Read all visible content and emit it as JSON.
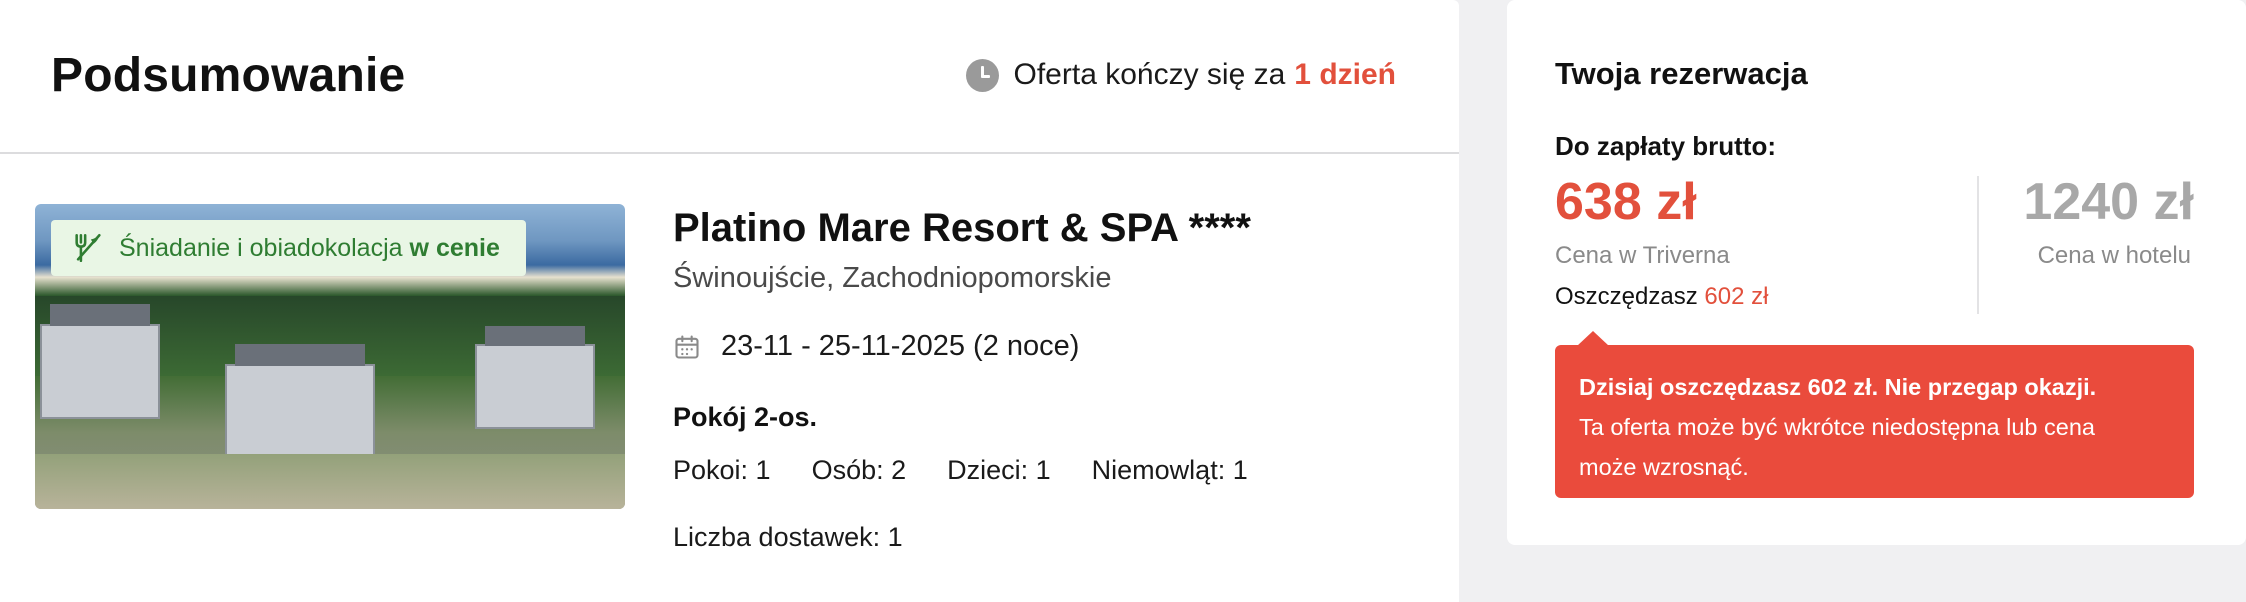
{
  "summary": {
    "title": "Podsumowanie",
    "offer_timer": {
      "prefix": "Oferta kończy się za",
      "value": "1 dzień"
    }
  },
  "hotel": {
    "meal_badge": {
      "text": "Śniadanie i obiadokolacja",
      "strong": "w cenie"
    },
    "name": "Platino Mare Resort & SPA ****",
    "location": "Świnoujście, Zachodniopomorskie",
    "dates": "23-11 - 25-11-2025 (2 noce)",
    "room_type": "Pokój 2-os.",
    "occupancy": [
      "Pokoi: 1",
      "Osób: 2",
      "Dzieci: 1",
      "Niemowląt: 1"
    ],
    "extra_beds": "Liczba dostawek: 1"
  },
  "reservation": {
    "title": "Twoja rezerwacja",
    "to_pay_label": "Do zapłaty brutto:",
    "price_triverna": "638 zł",
    "price_triverna_label": "Cena w Triverna",
    "savings_prefix": "Oszczędzasz",
    "savings_amount": "602 zł",
    "price_hotel": "1240 zł",
    "price_hotel_label": "Cena w hotelu",
    "alert": {
      "headline": "Dzisiaj oszczędzasz 602 zł. Nie przegap okazji.",
      "line1": "Ta oferta może być wkrótce niedostępna lub cena",
      "line2": "może wzrosnąć."
    }
  },
  "colors": {
    "accent": "#e2503c",
    "alert_bg": "#ea4b3c",
    "badge_bg": "#e9f6e5",
    "badge_text": "#2f7d32"
  },
  "icons": {
    "timer": "clock-icon",
    "meal": "fork-knife-icon",
    "dates": "calendar-icon"
  }
}
